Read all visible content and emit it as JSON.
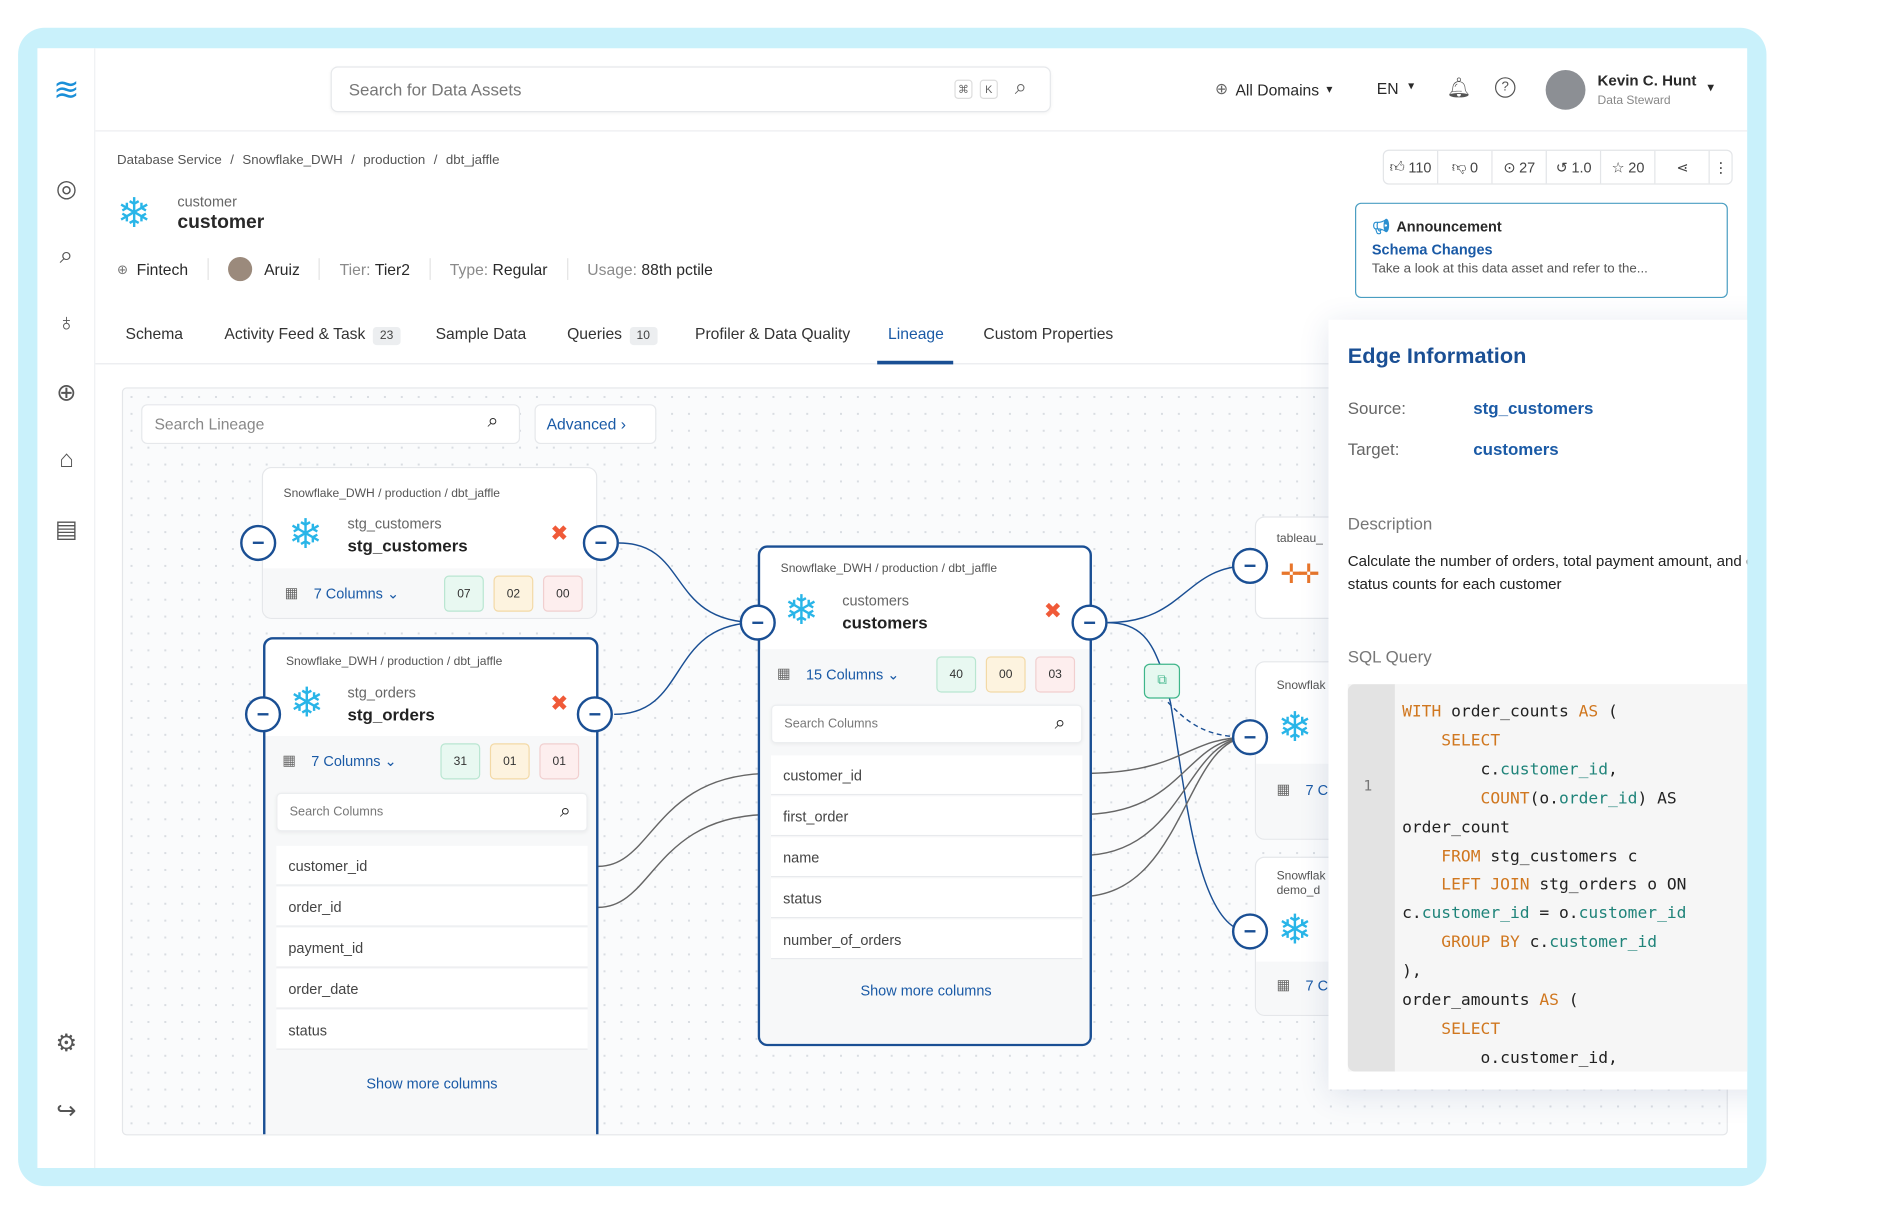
{
  "header": {
    "search_placeholder": "Search for Data Assets",
    "kbd_cmd": "⌘",
    "kbd_k": "K",
    "domains": "All Domains",
    "language": "EN",
    "user_name": "Kevin C. Hunt",
    "user_role": "Data Steward"
  },
  "breadcrumb": [
    "Database Service",
    "Snowflake_DWH",
    "production",
    "dbt_jaffle"
  ],
  "actions": {
    "likes": "110",
    "dislikes": "0",
    "followers": "27",
    "version": "1.0",
    "stars": "20"
  },
  "entity": {
    "display_name": "customer",
    "name": "customer",
    "domain": "Fintech",
    "owner": "Aruiz",
    "tier_label": "Tier:",
    "tier": "Tier2",
    "type_label": "Type:",
    "type": "Regular",
    "usage_label": "Usage:",
    "usage": "88th pctile"
  },
  "announcement": {
    "title": "Announcement",
    "subject": "Schema Changes",
    "text": "Take a look at this data asset and refer to the..."
  },
  "tabs": [
    {
      "label": "Schema"
    },
    {
      "label": "Activity Feed & Task",
      "count": "23"
    },
    {
      "label": "Sample Data"
    },
    {
      "label": "Queries",
      "count": "10"
    },
    {
      "label": "Profiler & Data Quality"
    },
    {
      "label": "Lineage",
      "active": true
    },
    {
      "label": "Custom Properties"
    }
  ],
  "lineage": {
    "search_placeholder": "Search Lineage",
    "advanced": "Advanced",
    "column_search_placeholder": "Search Columns",
    "show_more": "Show more columns",
    "nodes": {
      "stg_customers": {
        "path": "Snowflake_DWH / production / dbt_jaffle",
        "display": "stg_customers",
        "name": "stg_customers",
        "columns": "7 Columns",
        "counts": [
          "07",
          "02",
          "00"
        ]
      },
      "stg_orders": {
        "path": "Snowflake_DWH / production / dbt_jaffle",
        "display": "stg_orders",
        "name": "stg_orders",
        "columns": "7 Columns",
        "counts": [
          "31",
          "01",
          "01"
        ],
        "rows": [
          "customer_id",
          "order_id",
          "payment_id",
          "order_date",
          "status"
        ]
      },
      "customers": {
        "path": "Snowflake_DWH / production / dbt_jaffle",
        "display": "customers",
        "name": "customers",
        "columns": "15 Columns",
        "counts": [
          "40",
          "00",
          "03"
        ],
        "rows": [
          "customer_id",
          "first_order",
          "name",
          "status",
          "number_of_orders"
        ]
      },
      "right1": {
        "path": "tableau_"
      },
      "right2": {
        "path": "Snowflak",
        "columns": "7 C"
      },
      "right3": {
        "path": "Snowflak",
        "path2": "demo_d",
        "columns": "7 C"
      }
    }
  },
  "edge_panel": {
    "title": "Edge Information",
    "source_label": "Source:",
    "source": "stg_customers",
    "target_label": "Target:",
    "target": "customers",
    "description_label": "Description",
    "description": "Calculate the number of orders, total payment amount, and order status counts for each customer",
    "sql_label": "SQL Query",
    "line_number": "1",
    "code": [
      [
        [
          "WITH",
          "kw"
        ],
        [
          " order_counts ",
          ""
        ],
        [
          "AS",
          "kw"
        ],
        [
          " (",
          ""
        ]
      ],
      [
        [
          "    ",
          ""
        ],
        [
          "SELECT",
          "kw"
        ]
      ],
      [
        [
          "        c.",
          ""
        ],
        [
          "customer_id",
          "id"
        ],
        [
          ",",
          ""
        ]
      ],
      [
        [
          "        ",
          ""
        ],
        [
          "COUNT",
          "kw"
        ],
        [
          "(o.",
          ""
        ],
        [
          "order_id",
          "id"
        ],
        [
          ") AS",
          ""
        ]
      ],
      [
        [
          "order_count",
          ""
        ]
      ],
      [
        [
          "    ",
          ""
        ],
        [
          "FROM",
          "kw"
        ],
        [
          " stg_customers c",
          ""
        ]
      ],
      [
        [
          "    ",
          ""
        ],
        [
          "LEFT JOIN",
          "kw"
        ],
        [
          " stg_orders o ON",
          ""
        ]
      ],
      [
        [
          "c.",
          ""
        ],
        [
          "customer_id",
          "id"
        ],
        [
          " = o.",
          ""
        ],
        [
          "customer_id",
          "id"
        ]
      ],
      [
        [
          "    ",
          ""
        ],
        [
          "GROUP BY",
          "kw"
        ],
        [
          " c.",
          ""
        ],
        [
          "customer_id",
          "id"
        ]
      ],
      [
        [
          "),",
          ""
        ]
      ],
      [
        [
          "order_amounts ",
          ""
        ],
        [
          "AS",
          "kw"
        ],
        [
          " (",
          ""
        ]
      ],
      [
        [
          "    ",
          ""
        ],
        [
          "SELECT",
          "kw"
        ]
      ],
      [
        [
          "        o.customer_id,",
          ""
        ]
      ]
    ]
  },
  "colors": {
    "accent": "#1a4f94",
    "snowflake": "#29b5e8",
    "frame": "#c9f1fb",
    "sql_keyword": "#d0771f",
    "sql_identifier": "#20847a"
  }
}
